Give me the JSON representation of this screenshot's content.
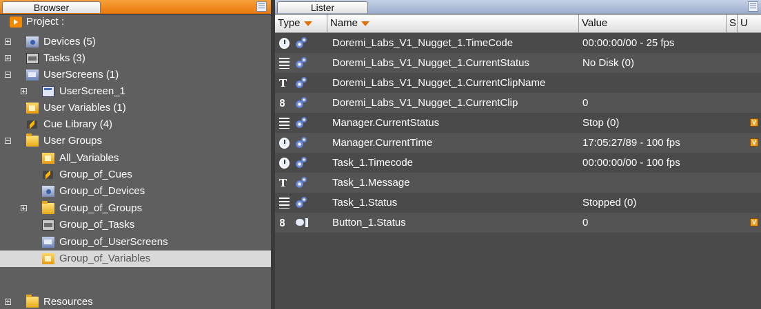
{
  "browser": {
    "tab_label": "Browser",
    "tree": [
      {
        "label": "Project :",
        "icon": "project-icon"
      },
      {
        "label": "Devices (5)",
        "icon": "devices-folder-icon"
      },
      {
        "label": "Tasks (3)",
        "icon": "tasks-folder-icon"
      },
      {
        "label": "UserScreens (1)",
        "icon": "userscreens-folder-icon"
      },
      {
        "label": "UserScreen_1",
        "icon": "userscreen-icon"
      },
      {
        "label": "User Variables (1)",
        "icon": "user-variables-icon"
      },
      {
        "label": "Cue Library (4)",
        "icon": "cue-library-icon"
      },
      {
        "label": "User Groups",
        "icon": "folder-icon"
      },
      {
        "label": "All_Variables",
        "icon": "variables-group-icon"
      },
      {
        "label": "Group_of_Cues",
        "icon": "cues-group-icon"
      },
      {
        "label": "Group_of_Devices",
        "icon": "devices-group-icon"
      },
      {
        "label": "Group_of_Groups",
        "icon": "folder-icon"
      },
      {
        "label": "Group_of_Tasks",
        "icon": "tasks-group-icon"
      },
      {
        "label": "Group_of_UserScreens",
        "icon": "userscreens-group-icon"
      },
      {
        "label": "Group_of_Variables",
        "icon": "variables-group-icon"
      },
      {
        "label": "Resources",
        "icon": "folder-icon"
      }
    ]
  },
  "lister": {
    "tab_label": "Lister",
    "columns": {
      "type": "Type",
      "name": "Name",
      "value": "Value",
      "s": "S",
      "u": "U"
    },
    "rows": [
      {
        "type_icon": "timecode-icon",
        "name": "Doremi_Labs_V1_Nugget_1.TimeCode",
        "value": "00:00:00/00 - 25 fps",
        "u_flag": ""
      },
      {
        "type_icon": "status-list-icon",
        "name": "Doremi_Labs_V1_Nugget_1.CurrentStatus",
        "value": "No Disk (0)",
        "u_flag": ""
      },
      {
        "type_icon": "text-icon",
        "name": "Doremi_Labs_V1_Nugget_1.CurrentClipName",
        "value": "",
        "u_flag": ""
      },
      {
        "type_icon": "number-icon",
        "name": "Doremi_Labs_V1_Nugget_1.CurrentClip",
        "value": "0",
        "u_flag": ""
      },
      {
        "type_icon": "status-list-icon",
        "name": "Manager.CurrentStatus",
        "value": "Stop (0)",
        "u_flag": "V"
      },
      {
        "type_icon": "timecode-icon",
        "name": "Manager.CurrentTime",
        "value": "17:05:27/89 - 100 fps",
        "u_flag": "V"
      },
      {
        "type_icon": "timecode-icon",
        "name": "Task_1.Timecode",
        "value": "00:00:00/00 - 100 fps",
        "u_flag": ""
      },
      {
        "type_icon": "text-icon",
        "name": "Task_1.Message",
        "value": "",
        "u_flag": ""
      },
      {
        "type_icon": "status-list-icon",
        "name": "Task_1.Status",
        "value": "Stopped (0)",
        "u_flag": ""
      },
      {
        "type_icon": "number-icon",
        "name": "Button_1.Status",
        "value": "0",
        "u_flag": "V"
      }
    ]
  },
  "colors": {
    "browser_tab_bar": "#e8780a",
    "lister_tab_bar": "#9aaccc",
    "selection": "#d9d9d9",
    "u_flag": "#f0a020"
  }
}
